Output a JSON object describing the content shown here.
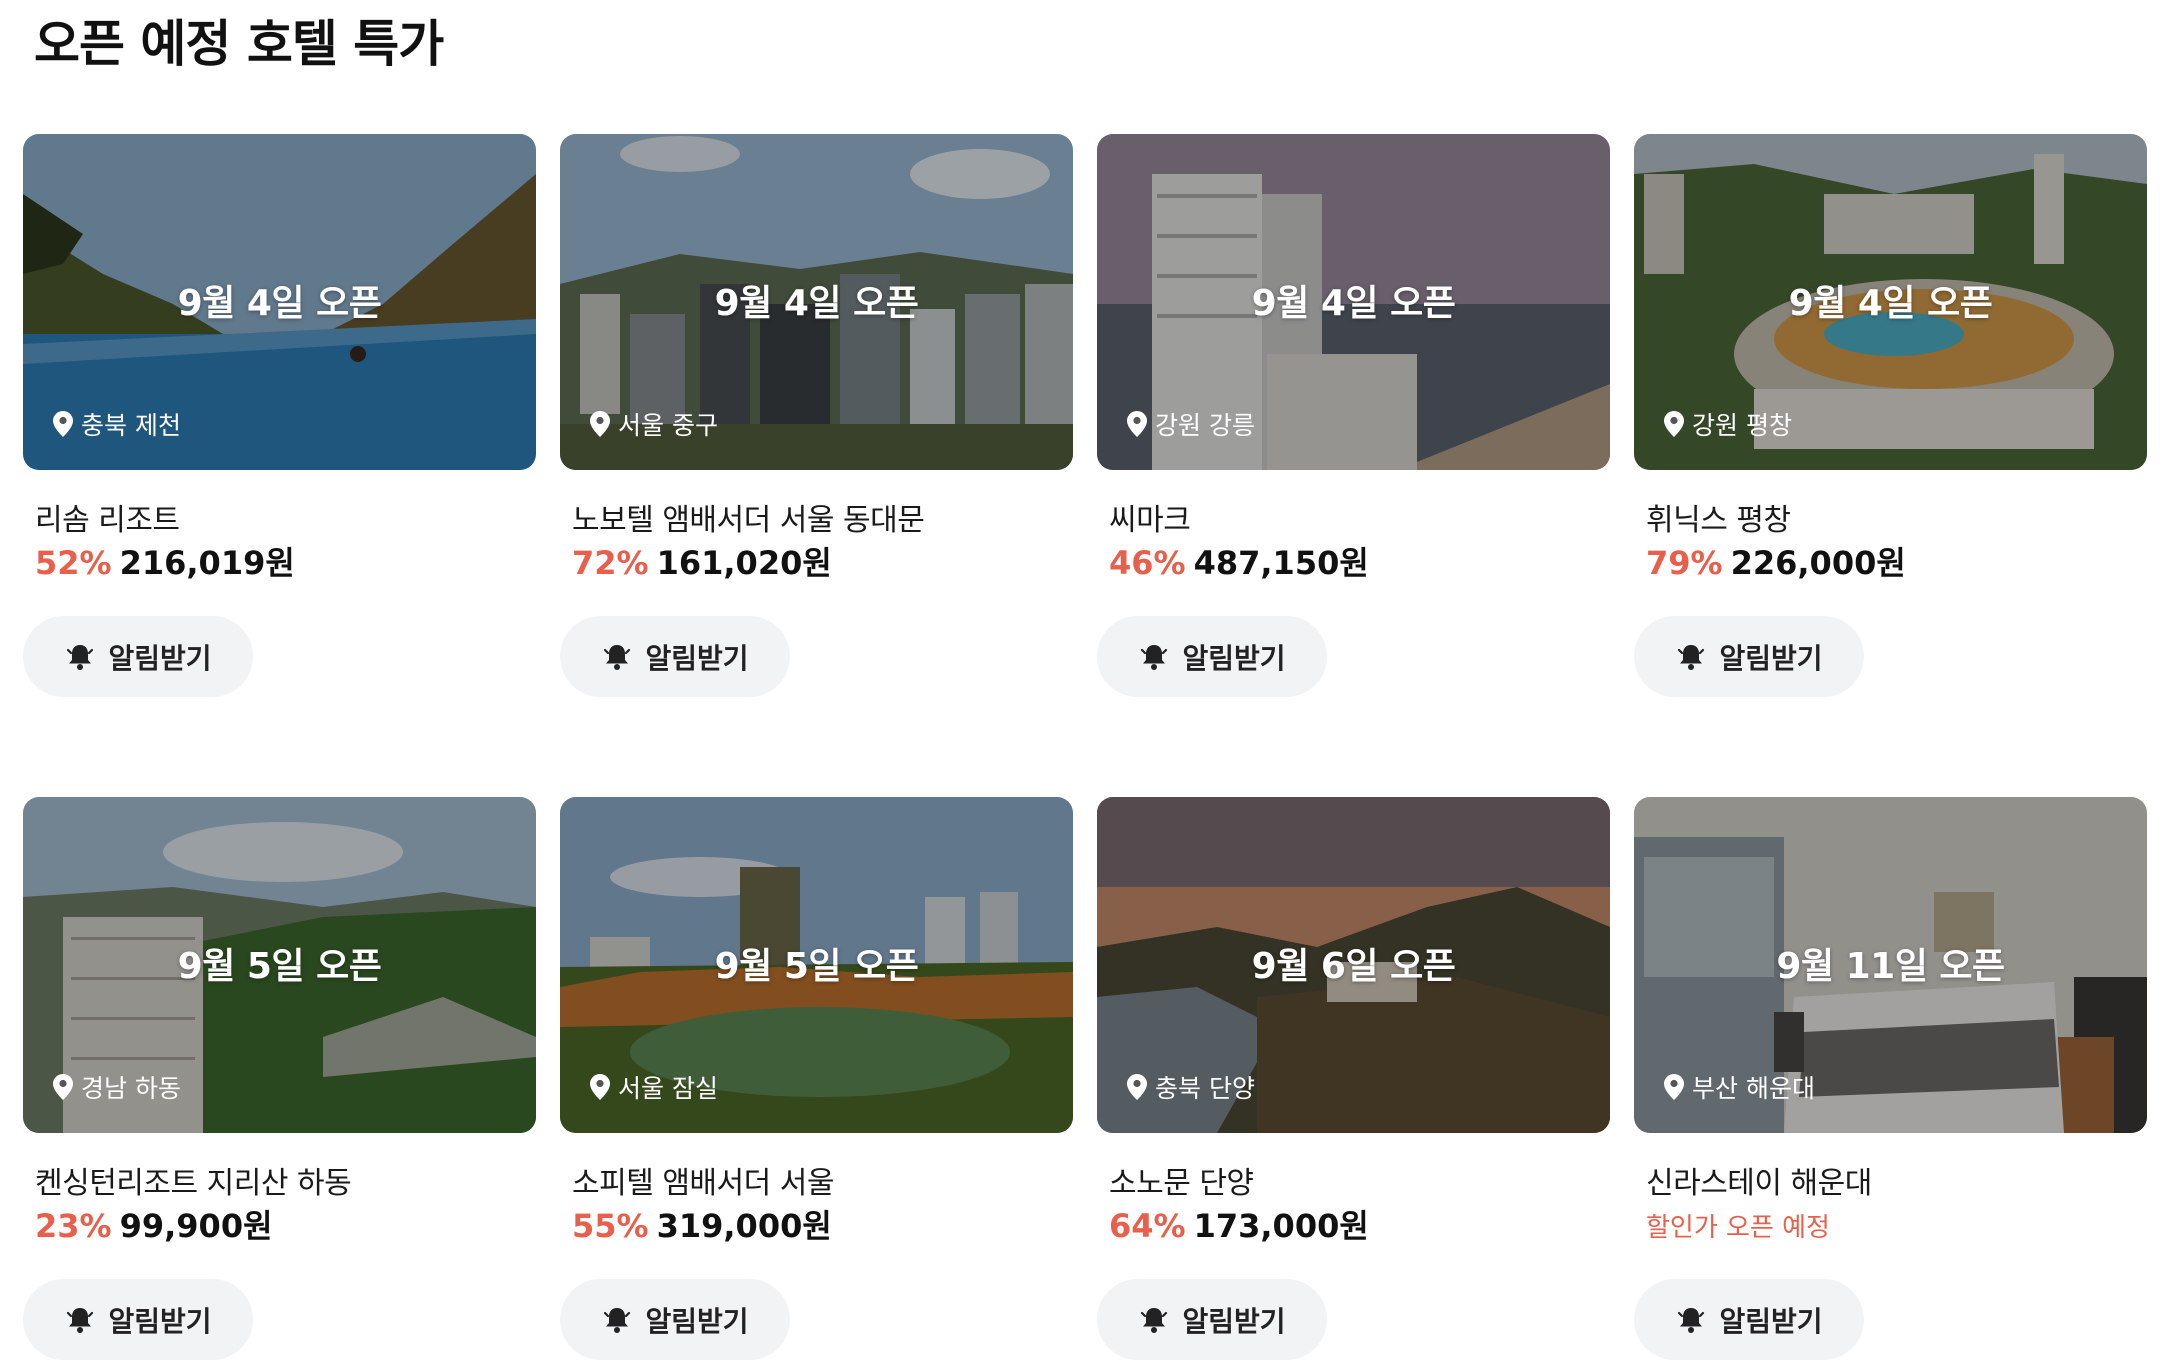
{
  "page": {
    "title": "오픈 예정 호텔 특가"
  },
  "common": {
    "alert_label": "알림받기"
  },
  "hotels": [
    {
      "open_date": "9월 4일 오픈",
      "location": "충북 제천",
      "name": "리솜 리조트",
      "discount": "52%",
      "price": "216,019원",
      "scene": "pool"
    },
    {
      "open_date": "9월 4일 오픈",
      "location": "서울 중구",
      "name": "노보텔 앰배서더 서울 동대문",
      "discount": "72%",
      "price": "161,020원",
      "scene": "city"
    },
    {
      "open_date": "9월 4일 오픈",
      "location": "강원 강릉",
      "name": "씨마크",
      "discount": "46%",
      "price": "487,150원",
      "scene": "seaside"
    },
    {
      "open_date": "9월 4일 오픈",
      "location": "강원 평창",
      "name": "휘닉스 평창",
      "discount": "79%",
      "price": "226,000원",
      "scene": "waterpark"
    },
    {
      "open_date": "9월 5일 오픈",
      "location": "경남 하동",
      "name": "켄싱턴리조트 지리산 하동",
      "discount": "23%",
      "price": "99,900원",
      "scene": "valley"
    },
    {
      "open_date": "9월 5일 오픈",
      "location": "서울 잠실",
      "name": "소피텔 앰배서더 서울",
      "discount": "55%",
      "price": "319,000원",
      "scene": "lake"
    },
    {
      "open_date": "9월 6일 오픈",
      "location": "충북 단양",
      "name": "소노문 단양",
      "discount": "64%",
      "price": "173,000원",
      "scene": "sunset"
    },
    {
      "open_date": "9월 11일 오픈",
      "location": "부산 해운대",
      "name": "신라스테이 해운대",
      "discount": "",
      "price": "",
      "notice": "할인가 오픈 예정",
      "scene": "room"
    }
  ]
}
